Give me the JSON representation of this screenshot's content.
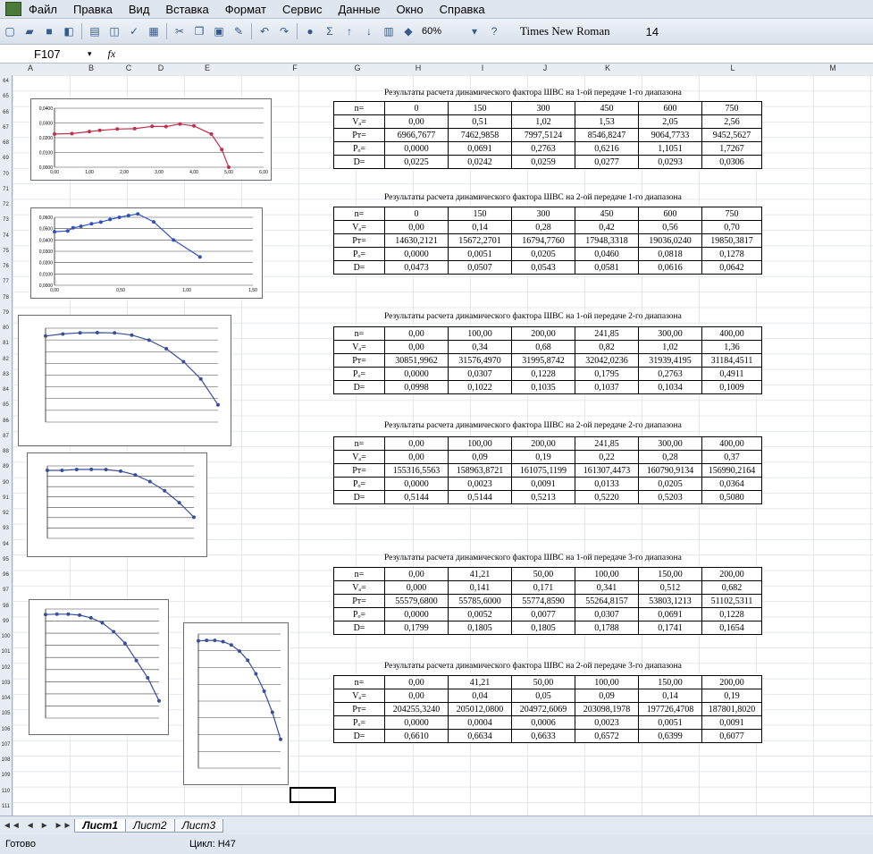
{
  "menu": {
    "items": [
      "Файл",
      "Правка",
      "Вид",
      "Вставка",
      "Формат",
      "Сервис",
      "Данные",
      "Окно",
      "Справка"
    ]
  },
  "toolbar": {
    "zoom": "60%",
    "font": "Times New Roman",
    "size": "14",
    "icons": [
      "new-icon",
      "open-icon",
      "save-icon",
      "permission-icon",
      "print-icon",
      "preview-icon",
      "spelling-icon",
      "research-icon",
      "cut-icon",
      "copy-icon",
      "paste-icon",
      "format-painter-icon",
      "undo-icon",
      "redo-icon",
      "hyperlink-icon",
      "autosum-icon",
      "sort-asc-icon",
      "sort-desc-icon",
      "chart-wizard-icon",
      "drawing-icon",
      "help-icon"
    ]
  },
  "formula": {
    "cell": "F107",
    "fx": "fx"
  },
  "columns": [
    "A",
    "B",
    "C",
    "D",
    "E",
    "F",
    "G",
    "H",
    "I",
    "J",
    "K",
    "L",
    "M"
  ],
  "rows": [
    "64",
    "65",
    "66",
    "67",
    "68",
    "69",
    "70",
    "71",
    "72",
    "73",
    "74",
    "75",
    "76",
    "77",
    "78",
    "79",
    "80",
    "81",
    "82",
    "83",
    "84",
    "85",
    "86",
    "87",
    "88",
    "89",
    "90",
    "91",
    "92",
    "93",
    "94",
    "95",
    "96",
    "97",
    "98",
    "99",
    "100",
    "101",
    "102",
    "103",
    "104",
    "105",
    "106",
    "107",
    "108",
    "109",
    "110",
    "111"
  ],
  "tables": [
    {
      "title": "Результаты расчета динамического фактора ШВС на 1-ой передаче 1-го диапазона",
      "rows": [
        {
          "label": "n=",
          "values": [
            "0",
            "150",
            "300",
            "450",
            "600",
            "750"
          ]
        },
        {
          "label": "Vₐ=",
          "values": [
            "0,00",
            "0,51",
            "1,02",
            "1,53",
            "2,05",
            "2,56"
          ]
        },
        {
          "label": "Pт=",
          "values": [
            "6966,7677",
            "7462,9858",
            "7997,5124",
            "8546,8247",
            "9064,7733",
            "9452,5627"
          ]
        },
        {
          "label": "Pₒ=",
          "values": [
            "0,0000",
            "0,0691",
            "0,2763",
            "0,6216",
            "1,1051",
            "1,7267"
          ]
        },
        {
          "label": "D=",
          "values": [
            "0,0225",
            "0,0242",
            "0,0259",
            "0,0277",
            "0,0293",
            "0,0306"
          ]
        }
      ]
    },
    {
      "title": "Результаты расчета динамического фактора ШВС на 2-ой передаче 1-го диапазона",
      "rows": [
        {
          "label": "n=",
          "values": [
            "0",
            "150",
            "300",
            "450",
            "600",
            "750"
          ]
        },
        {
          "label": "Vₐ=",
          "values": [
            "0,00",
            "0,14",
            "0,28",
            "0,42",
            "0,56",
            "0,70"
          ]
        },
        {
          "label": "Pт=",
          "values": [
            "14630,2121",
            "15672,2701",
            "16794,7760",
            "17948,3318",
            "19036,0240",
            "19850,3817"
          ]
        },
        {
          "label": "Pₒ=",
          "values": [
            "0,0000",
            "0,0051",
            "0,0205",
            "0,0460",
            "0,0818",
            "0,1278"
          ]
        },
        {
          "label": "D=",
          "values": [
            "0,0473",
            "0,0507",
            "0,0543",
            "0,0581",
            "0,0616",
            "0,0642"
          ]
        }
      ]
    },
    {
      "title": "Результаты расчета динамического фактора ШВС на 1-ой передаче 2-го диапазона",
      "rows": [
        {
          "label": "n=",
          "values": [
            "0,00",
            "100,00",
            "200,00",
            "241,85",
            "300,00",
            "400,00"
          ]
        },
        {
          "label": "Vₐ=",
          "values": [
            "0,00",
            "0,34",
            "0,68",
            "0,82",
            "1,02",
            "1,36"
          ]
        },
        {
          "label": "Pт=",
          "values": [
            "30851,9962",
            "31576,4970",
            "31995,8742",
            "32042,0236",
            "31939,4195",
            "31184,4511"
          ]
        },
        {
          "label": "Pₒ=",
          "values": [
            "0,0000",
            "0,0307",
            "0,1228",
            "0,1795",
            "0,2763",
            "0,4911"
          ]
        },
        {
          "label": "D=",
          "values": [
            "0,0998",
            "0,1022",
            "0,1035",
            "0,1037",
            "0,1034",
            "0,1009"
          ]
        }
      ]
    },
    {
      "title": "Результаты расчета динамического фактора ШВС на 2-ой передаче 2-го диапазона",
      "rows": [
        {
          "label": "n=",
          "values": [
            "0,00",
            "100,00",
            "200,00",
            "241,85",
            "300,00",
            "400,00"
          ]
        },
        {
          "label": "Vₐ=",
          "values": [
            "0,00",
            "0,09",
            "0,19",
            "0,22",
            "0,28",
            "0,37"
          ]
        },
        {
          "label": "Pт=",
          "values": [
            "155316,5563",
            "158963,8721",
            "161075,1199",
            "161307,4473",
            "160790,9134",
            "156990,2164"
          ]
        },
        {
          "label": "Pₒ=",
          "values": [
            "0,0000",
            "0,0023",
            "0,0091",
            "0,0133",
            "0,0205",
            "0,0364"
          ]
        },
        {
          "label": "D=",
          "values": [
            "0,5144",
            "0,5144",
            "0,5213",
            "0,5220",
            "0,5203",
            "0,5080"
          ]
        }
      ]
    },
    {
      "title": "Результаты расчета динамического фактора ШВС на 1-ой передаче 3-го диапазона",
      "rows": [
        {
          "label": "n=",
          "values": [
            "0,00",
            "41,21",
            "50,00",
            "100,00",
            "150,00",
            "200,00"
          ]
        },
        {
          "label": "Vₐ=",
          "values": [
            "0,000",
            "0,141",
            "0,171",
            "0,341",
            "0,512",
            "0,682"
          ]
        },
        {
          "label": "Pт=",
          "values": [
            "55579,6800",
            "55785,6000",
            "55774,8590",
            "55264,8157",
            "53803,1213",
            "51102,5311"
          ]
        },
        {
          "label": "Pₒ=",
          "values": [
            "0,0000",
            "0,0052",
            "0,0077",
            "0,0307",
            "0,0691",
            "0,1228"
          ]
        },
        {
          "label": "D=",
          "values": [
            "0,1799",
            "0,1805",
            "0,1805",
            "0,1788",
            "0,1741",
            "0,1654"
          ]
        }
      ]
    },
    {
      "title": "Результаты расчета динамического фактора ШВС на 2-ой передаче 3-го диапазона",
      "rows": [
        {
          "label": "n=",
          "values": [
            "0,00",
            "41,21",
            "50,00",
            "100,00",
            "150,00",
            "200,00"
          ]
        },
        {
          "label": "Vₐ=",
          "values": [
            "0,00",
            "0,04",
            "0,05",
            "0,09",
            "0,14",
            "0,19"
          ]
        },
        {
          "label": "Pт=",
          "values": [
            "204255,3240",
            "205012,0800",
            "204972,6069",
            "203098,1978",
            "197726,4708",
            "187801,8020"
          ]
        },
        {
          "label": "Pₒ=",
          "values": [
            "0,0000",
            "0,0004",
            "0,0006",
            "0,0023",
            "0,0051",
            "0,0091"
          ]
        },
        {
          "label": "D=",
          "values": [
            "0,6610",
            "0,6634",
            "0,6633",
            "0,6572",
            "0,6399",
            "0,6077"
          ]
        }
      ]
    }
  ],
  "chart_labels": {
    "c1_y": [
      "0,0400",
      "0,0300",
      "0,0200",
      "0,0100",
      "0,0000"
    ],
    "c1_x": [
      "0,00",
      "1,00",
      "2,00",
      "3,00",
      "4,00",
      "5,00",
      "6,00"
    ],
    "c2_y": [
      "0,0600",
      "0,0500",
      "0,0400",
      "0,0300",
      "0,0200",
      "0,0100",
      "0,0000"
    ],
    "c2_x": [
      "0,00",
      "0,50",
      "1,00",
      "1,50"
    ]
  },
  "chart_data": [
    {
      "type": "line",
      "series": [
        {
          "values": [
            0.0225,
            0.0228,
            0.0242,
            0.025,
            0.0259,
            0.0261,
            0.0277,
            0.0276,
            0.0293,
            0.028,
            0.0225,
            0.012,
            0.0
          ]
        }
      ],
      "x": [
        0,
        0.5,
        1.0,
        1.3,
        1.8,
        2.3,
        2.8,
        3.2,
        3.6,
        4.0,
        4.5,
        4.8,
        5.0
      ],
      "ylim": [
        0,
        0.04
      ],
      "xlim": [
        0,
        6
      ],
      "color": "#c0304a"
    },
    {
      "type": "line",
      "series": [
        {
          "values": [
            0.0473,
            0.048,
            0.0507,
            0.052,
            0.0543,
            0.0558,
            0.0581,
            0.06,
            0.0616,
            0.063,
            0.056,
            0.04,
            0.025
          ]
        }
      ],
      "x": [
        0,
        0.1,
        0.14,
        0.2,
        0.28,
        0.35,
        0.42,
        0.49,
        0.56,
        0.63,
        0.75,
        0.9,
        1.1
      ],
      "ylim": [
        0,
        0.06
      ],
      "xlim": [
        0,
        1.5
      ],
      "color": "#3050c0"
    },
    {
      "type": "line",
      "series": [
        {
          "values": [
            0.0998,
            0.1022,
            0.1035,
            0.1037,
            0.1034,
            0.1009,
            0.095,
            0.085,
            0.07,
            0.05,
            0.02
          ]
        }
      ]
    },
    {
      "type": "line",
      "series": [
        {
          "values": [
            0.5144,
            0.5144,
            0.5213,
            0.522,
            0.5203,
            0.508,
            0.48,
            0.43,
            0.36,
            0.27,
            0.16
          ]
        }
      ]
    },
    {
      "type": "line",
      "series": [
        {
          "values": [
            0.1799,
            0.1805,
            0.1805,
            0.1788,
            0.1741,
            0.1654,
            0.15,
            0.13,
            0.1,
            0.07,
            0.03
          ]
        }
      ]
    },
    {
      "type": "line",
      "series": [
        {
          "values": [
            0.661,
            0.6634,
            0.6633,
            0.6572,
            0.6399,
            0.6077,
            0.56,
            0.49,
            0.4,
            0.29,
            0.15
          ]
        }
      ]
    }
  ],
  "sheets": [
    "Лист1",
    "Лист2",
    "Лист3"
  ],
  "sheet_nav": [
    "◄◄",
    "◄",
    "►",
    "►►"
  ],
  "status": {
    "ready": "Готово",
    "cycle": "Цикл: H47"
  }
}
